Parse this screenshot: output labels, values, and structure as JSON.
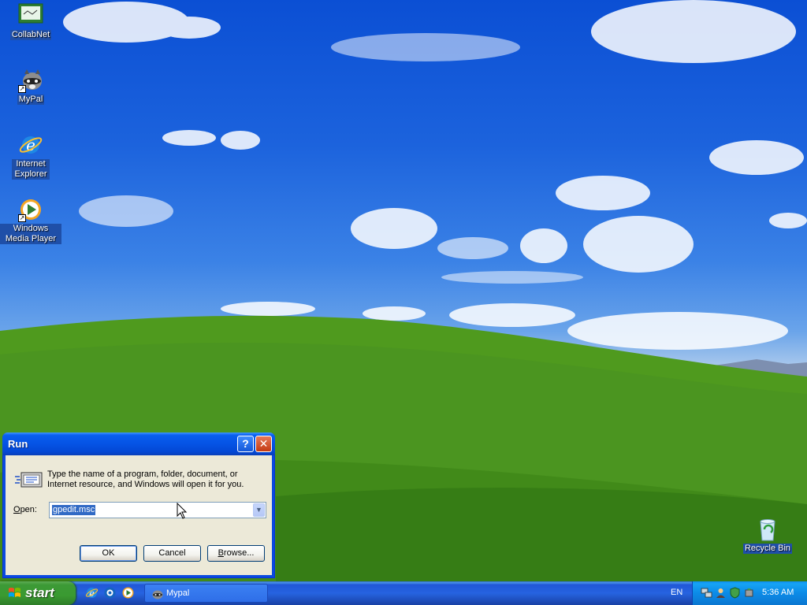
{
  "desktop": {
    "icons": [
      {
        "label": "CollabNet",
        "icon": "collabnet-icon"
      },
      {
        "label": "MyPal",
        "icon": "mypal-raccoon-icon"
      },
      {
        "label": "Internet Explorer",
        "icon": "internet-explorer-icon"
      },
      {
        "label": "Windows Media Player",
        "icon": "media-player-icon"
      },
      {
        "label": "Recycle Bin",
        "icon": "recycle-bin-icon"
      }
    ]
  },
  "run_dialog": {
    "title": "Run",
    "message": "Type the name of a program, folder, document, or Internet resource, and Windows will open it for you.",
    "open_label_prefix": "O",
    "open_label_rest": "pen:",
    "open_value": "gpedit.msc",
    "ok_label": "OK",
    "cancel_label": "Cancel",
    "browse_label_prefix": "B",
    "browse_label_rest": "rowse...",
    "help_glyph": "?",
    "close_glyph": "✕"
  },
  "taskbar": {
    "start_label": "start",
    "quick_launch": [
      "internet-explorer-icon",
      "browser-icon",
      "media-player-icon"
    ],
    "tasks": [
      {
        "label": "Mypal",
        "icon": "mypal-raccoon-icon"
      }
    ],
    "language": "EN",
    "clock": "5:36 AM",
    "tray_icons": [
      "network-icon",
      "user-icon",
      "security-icon",
      "safely-remove-icon"
    ]
  },
  "colors": {
    "title_blue": "#0553e4",
    "start_green": "#3a9a31",
    "dialog_bg": "#ece9d8",
    "selection": "#316ac5"
  }
}
